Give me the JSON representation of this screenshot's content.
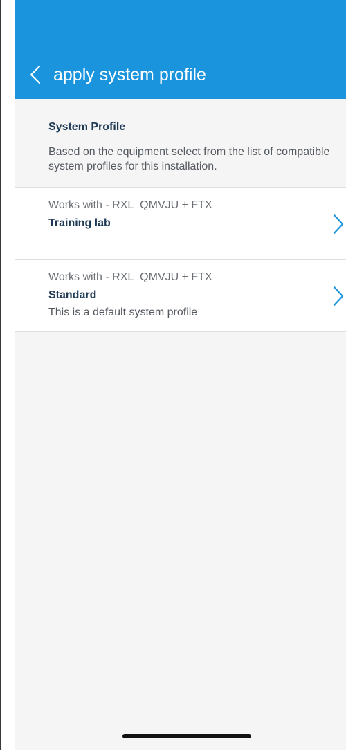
{
  "colors": {
    "header_bg": "#1a94dd",
    "page_bg": "#f5f5f5",
    "accent": "#1a94dd",
    "title_text": "#1e3a55"
  },
  "header": {
    "back_icon": "chevron-left-icon",
    "title": "apply system profile"
  },
  "intro": {
    "title": "System Profile",
    "description": "Based on the equipment select from the list of compatible system profiles for this installation."
  },
  "profiles": [
    {
      "works_with": "Works with - RXL_QMVJU + FTX",
      "name": "Training lab",
      "description": "",
      "icon": "chevron-right-icon"
    },
    {
      "works_with": "Works with - RXL_QMVJU + FTX",
      "name": "Standard",
      "description": "This is a default system profile",
      "icon": "chevron-right-icon"
    }
  ]
}
